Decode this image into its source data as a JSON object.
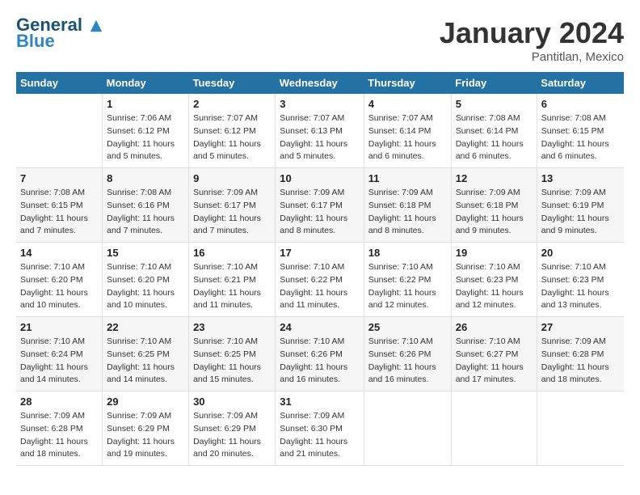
{
  "header": {
    "logo_general": "General",
    "logo_blue": "Blue",
    "month_title": "January 2024",
    "location": "Pantitlan, Mexico"
  },
  "weekdays": [
    "Sunday",
    "Monday",
    "Tuesday",
    "Wednesday",
    "Thursday",
    "Friday",
    "Saturday"
  ],
  "weeks": [
    [
      {
        "day": "",
        "info": ""
      },
      {
        "day": "1",
        "info": "Sunrise: 7:06 AM\nSunset: 6:12 PM\nDaylight: 11 hours\nand 5 minutes."
      },
      {
        "day": "2",
        "info": "Sunrise: 7:07 AM\nSunset: 6:12 PM\nDaylight: 11 hours\nand 5 minutes."
      },
      {
        "day": "3",
        "info": "Sunrise: 7:07 AM\nSunset: 6:13 PM\nDaylight: 11 hours\nand 5 minutes."
      },
      {
        "day": "4",
        "info": "Sunrise: 7:07 AM\nSunset: 6:14 PM\nDaylight: 11 hours\nand 6 minutes."
      },
      {
        "day": "5",
        "info": "Sunrise: 7:08 AM\nSunset: 6:14 PM\nDaylight: 11 hours\nand 6 minutes."
      },
      {
        "day": "6",
        "info": "Sunrise: 7:08 AM\nSunset: 6:15 PM\nDaylight: 11 hours\nand 6 minutes."
      }
    ],
    [
      {
        "day": "7",
        "info": "Sunrise: 7:08 AM\nSunset: 6:15 PM\nDaylight: 11 hours\nand 7 minutes."
      },
      {
        "day": "8",
        "info": "Sunrise: 7:08 AM\nSunset: 6:16 PM\nDaylight: 11 hours\nand 7 minutes."
      },
      {
        "day": "9",
        "info": "Sunrise: 7:09 AM\nSunset: 6:17 PM\nDaylight: 11 hours\nand 7 minutes."
      },
      {
        "day": "10",
        "info": "Sunrise: 7:09 AM\nSunset: 6:17 PM\nDaylight: 11 hours\nand 8 minutes."
      },
      {
        "day": "11",
        "info": "Sunrise: 7:09 AM\nSunset: 6:18 PM\nDaylight: 11 hours\nand 8 minutes."
      },
      {
        "day": "12",
        "info": "Sunrise: 7:09 AM\nSunset: 6:18 PM\nDaylight: 11 hours\nand 9 minutes."
      },
      {
        "day": "13",
        "info": "Sunrise: 7:09 AM\nSunset: 6:19 PM\nDaylight: 11 hours\nand 9 minutes."
      }
    ],
    [
      {
        "day": "14",
        "info": "Sunrise: 7:10 AM\nSunset: 6:20 PM\nDaylight: 11 hours\nand 10 minutes."
      },
      {
        "day": "15",
        "info": "Sunrise: 7:10 AM\nSunset: 6:20 PM\nDaylight: 11 hours\nand 10 minutes."
      },
      {
        "day": "16",
        "info": "Sunrise: 7:10 AM\nSunset: 6:21 PM\nDaylight: 11 hours\nand 11 minutes."
      },
      {
        "day": "17",
        "info": "Sunrise: 7:10 AM\nSunset: 6:22 PM\nDaylight: 11 hours\nand 11 minutes."
      },
      {
        "day": "18",
        "info": "Sunrise: 7:10 AM\nSunset: 6:22 PM\nDaylight: 11 hours\nand 12 minutes."
      },
      {
        "day": "19",
        "info": "Sunrise: 7:10 AM\nSunset: 6:23 PM\nDaylight: 11 hours\nand 12 minutes."
      },
      {
        "day": "20",
        "info": "Sunrise: 7:10 AM\nSunset: 6:23 PM\nDaylight: 11 hours\nand 13 minutes."
      }
    ],
    [
      {
        "day": "21",
        "info": "Sunrise: 7:10 AM\nSunset: 6:24 PM\nDaylight: 11 hours\nand 14 minutes."
      },
      {
        "day": "22",
        "info": "Sunrise: 7:10 AM\nSunset: 6:25 PM\nDaylight: 11 hours\nand 14 minutes."
      },
      {
        "day": "23",
        "info": "Sunrise: 7:10 AM\nSunset: 6:25 PM\nDaylight: 11 hours\nand 15 minutes."
      },
      {
        "day": "24",
        "info": "Sunrise: 7:10 AM\nSunset: 6:26 PM\nDaylight: 11 hours\nand 16 minutes."
      },
      {
        "day": "25",
        "info": "Sunrise: 7:10 AM\nSunset: 6:26 PM\nDaylight: 11 hours\nand 16 minutes."
      },
      {
        "day": "26",
        "info": "Sunrise: 7:10 AM\nSunset: 6:27 PM\nDaylight: 11 hours\nand 17 minutes."
      },
      {
        "day": "27",
        "info": "Sunrise: 7:09 AM\nSunset: 6:28 PM\nDaylight: 11 hours\nand 18 minutes."
      }
    ],
    [
      {
        "day": "28",
        "info": "Sunrise: 7:09 AM\nSunset: 6:28 PM\nDaylight: 11 hours\nand 18 minutes."
      },
      {
        "day": "29",
        "info": "Sunrise: 7:09 AM\nSunset: 6:29 PM\nDaylight: 11 hours\nand 19 minutes."
      },
      {
        "day": "30",
        "info": "Sunrise: 7:09 AM\nSunset: 6:29 PM\nDaylight: 11 hours\nand 20 minutes."
      },
      {
        "day": "31",
        "info": "Sunrise: 7:09 AM\nSunset: 6:30 PM\nDaylight: 11 hours\nand 21 minutes."
      },
      {
        "day": "",
        "info": ""
      },
      {
        "day": "",
        "info": ""
      },
      {
        "day": "",
        "info": ""
      }
    ]
  ]
}
